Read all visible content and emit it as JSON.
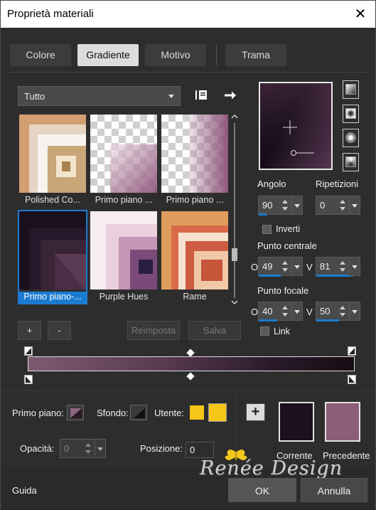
{
  "window": {
    "title": "Proprietà materiali",
    "close_glyph": "✕"
  },
  "tabs": [
    {
      "label": "Colore",
      "active": false
    },
    {
      "label": "Gradiente",
      "active": true
    },
    {
      "label": "Motivo",
      "active": false
    },
    {
      "label": "Trama",
      "active": false
    }
  ],
  "library": {
    "category": "Tutto",
    "book_icon": "book-icon",
    "arrow_icon": "arrow-right-icon",
    "items": [
      {
        "label": "Polished Co...",
        "selected": false
      },
      {
        "label": "Primo piano ...",
        "selected": false
      },
      {
        "label": "Primo piano ...",
        "selected": false
      },
      {
        "label": "Primo piano-...",
        "selected": true
      },
      {
        "label": "Purple Hues",
        "selected": false
      },
      {
        "label": "Rame",
        "selected": false
      }
    ],
    "add_label": "+",
    "remove_label": "-",
    "reset_label": "Reimposta",
    "save_label": "Salva"
  },
  "params": {
    "angle_label": "Angolo",
    "angle_value": "90",
    "repeat_label": "Ripetizioni",
    "repeat_value": "0",
    "invert_label": "Inverti",
    "invert_checked": false,
    "center_label": "Punto centrale",
    "center_h_label": "O",
    "center_h_value": "49",
    "center_v_label": "V",
    "center_v_value": "81",
    "focal_label": "Punto focale",
    "focal_h_label": "O",
    "focal_h_value": "40",
    "focal_v_label": "V",
    "focal_v_value": "50",
    "link_label": "Link",
    "link_checked": false
  },
  "gradient_colors": {
    "start": "#7e5a72",
    "end": "#150c15"
  },
  "materials": {
    "foreground_label": "Primo piano:",
    "background_label": "Sfondo:",
    "user_label": "Utente:",
    "user_color": "#f5c518",
    "opacity_label": "Opacità:",
    "opacity_value": "0",
    "position_label": "Posizione:",
    "position_value": "0",
    "add_label": "+",
    "current_label": "Corrente",
    "previous_label": "Precedente",
    "current_color": "#1b101c",
    "previous_color": "#8c5e78"
  },
  "watermark": {
    "text": "Renée Design"
  },
  "footer": {
    "help_label": "Guida",
    "ok_label": "OK",
    "cancel_label": "Annulla"
  }
}
